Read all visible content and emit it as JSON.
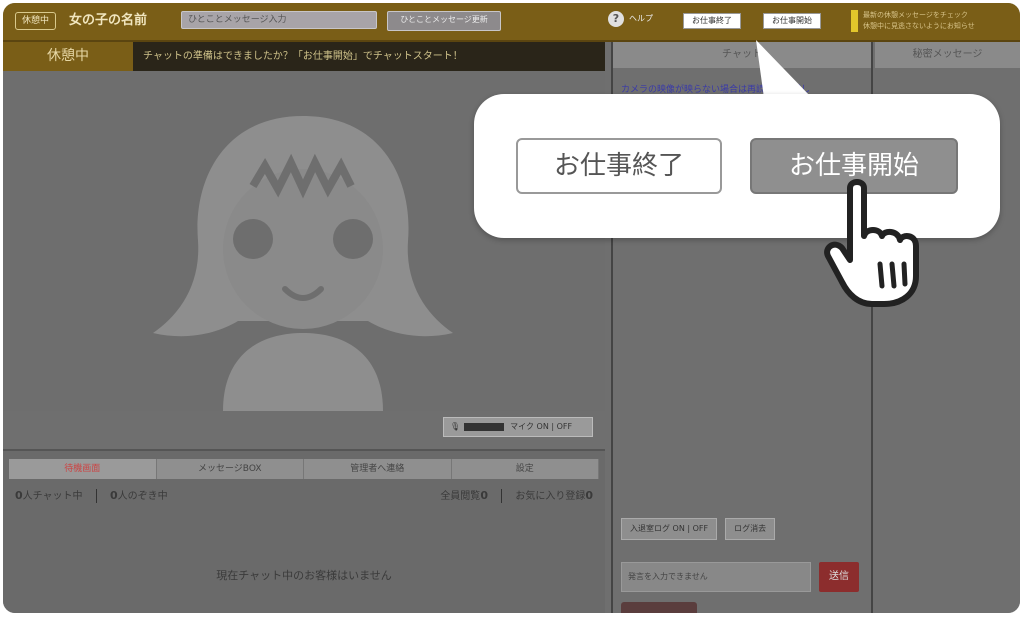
{
  "header": {
    "status_label": "休憩中",
    "girl_name": "女の子の名前",
    "oneline_placeholder": "ひとことメッセージ入力",
    "oneline_update_label": "ひとことメッセージ更新",
    "help_label": "ヘルプ",
    "work_end_label": "お仕事終了",
    "work_start_label": "お仕事開始",
    "note_line1": "最新の休憩メッセージをチェック",
    "note_line2": "休憩中に見逃さないようにお知らせ"
  },
  "video": {
    "rest_badge": "休憩中",
    "rest_message": "チャットの準備はできましたか？「お仕事開始」でチャットスタート！",
    "mic_label": "マイク ON | OFF"
  },
  "lower_panel": {
    "tabs": [
      {
        "label": "待機画面"
      },
      {
        "label": "メッセージBOX"
      },
      {
        "label": "管理者へ連絡"
      },
      {
        "label": "設定"
      }
    ],
    "count_chatting_num": "0",
    "count_chatting_label": "人チャット中",
    "count_waiting_num": "0",
    "count_waiting_label": "人のぞき中",
    "count_total_label": "全員閲覧",
    "count_total_num": "0",
    "count_favorite_label": "お気に入り登録",
    "count_favorite_num": "0",
    "no_customer_text": "現在チャット中のお客様はいません"
  },
  "chat": {
    "title": "チャット",
    "first_message": "カメラの映像が映らない場合は再読込でお試し",
    "log_toggle_label": "入退室ログ ON | OFF",
    "log_clear_label": "ログ消去",
    "input_placeholder": "発言を入力できません",
    "send_label": "送信"
  },
  "secret": {
    "title": "秘密メッセージ"
  },
  "callout": {
    "end_button_label": "お仕事終了",
    "start_button_label": "お仕事開始"
  },
  "colors": {
    "header_brown": "#7a5e17",
    "send_red": "#8c2d2d",
    "dim_gray": "#6f6f6f"
  }
}
